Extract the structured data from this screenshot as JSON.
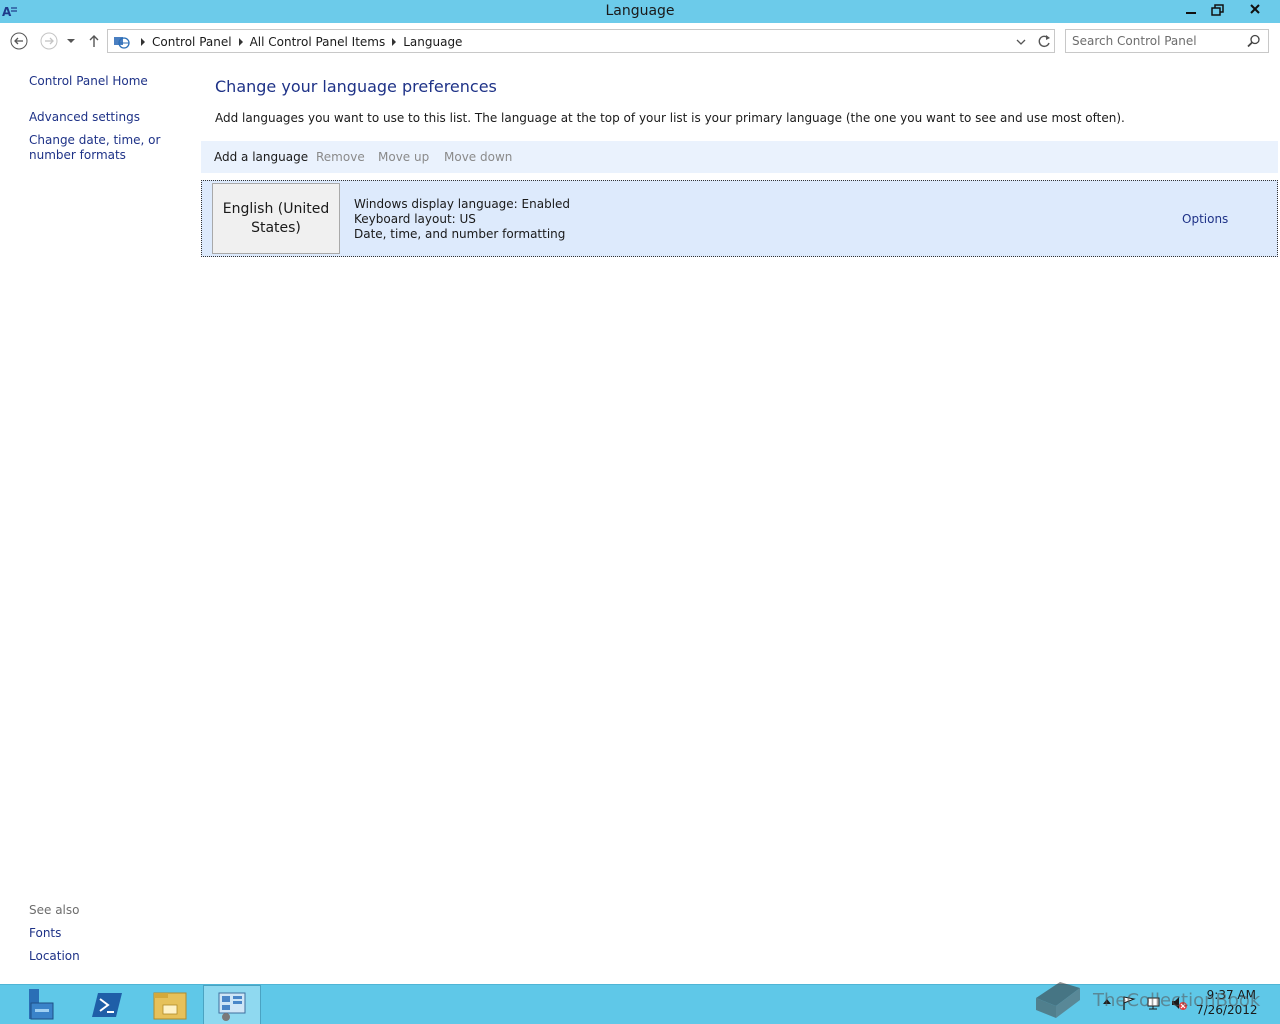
{
  "window": {
    "title": "Language"
  },
  "address_bar": {
    "breadcrumbs": [
      "Control Panel",
      "All Control Panel Items",
      "Language"
    ]
  },
  "search": {
    "placeholder": "Search Control Panel"
  },
  "left_pane": {
    "home_link": "Control Panel Home",
    "links": [
      "Advanced settings",
      "Change date, time, or number formats"
    ],
    "see_also_label": "See also",
    "see_also_links": [
      "Fonts",
      "Location"
    ]
  },
  "main": {
    "heading": "Change your language preferences",
    "description": "Add languages you want to use to this list. The language at the top of your list is your primary language (the one you want to see and use most often).",
    "toolbar": {
      "add": "Add a language",
      "remove": "Remove",
      "move_up": "Move up",
      "move_down": "Move down"
    },
    "languages": [
      {
        "name": "English (United States)",
        "details": [
          "Windows display language: Enabled",
          "Keyboard layout: US",
          "Date, time, and number formatting"
        ],
        "options_label": "Options"
      }
    ]
  },
  "taskbar": {
    "time": "9:37 AM",
    "date": "7/26/2012",
    "items": [
      "server-manager-icon",
      "powershell-icon",
      "file-explorer-icon",
      "control-panel-icon"
    ]
  },
  "watermark": {
    "text": "TheCollectionBook"
  },
  "colors": {
    "title_bar": "#6ccbea",
    "link": "#1e3287",
    "selection": "#ddeafc",
    "taskbar": "#5fc8e8"
  }
}
